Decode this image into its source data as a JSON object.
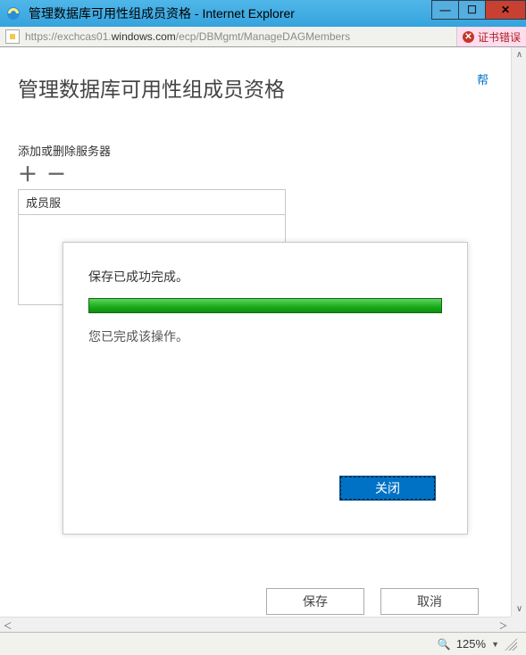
{
  "window": {
    "title": "管理数据库可用性组成员资格 - Internet Explorer"
  },
  "address": {
    "prefix": "https://exchcas01.",
    "domain": "windows.com",
    "path": "/ecp/DBMgmt/ManageDAGMembers",
    "cert_error": "证书错误"
  },
  "page": {
    "help": "帮",
    "title": "管理数据库可用性组成员资格",
    "section_label": "添加或删除服务器",
    "toolbar": {
      "add": "＋",
      "remove": "－"
    },
    "member_header": "成员服",
    "actions": {
      "save": "保存",
      "cancel": "取消"
    }
  },
  "dialog": {
    "title": "保存已成功完成。",
    "body": "您已完成该操作。",
    "close": "关闭"
  },
  "status": {
    "zoom": "125%"
  }
}
